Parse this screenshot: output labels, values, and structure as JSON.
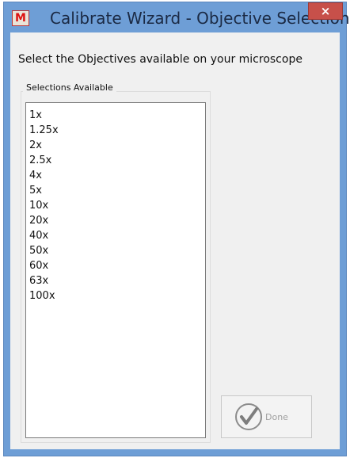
{
  "window": {
    "title": "Calibrate Wizard - Objective Selection",
    "app_icon_glyph": "M",
    "close_glyph": "×"
  },
  "instructions": "Select the Objectives available on your microscope",
  "selections": {
    "label": "Selections Available",
    "items": [
      "1x",
      "1.25x",
      "2x",
      "2.5x",
      "4x",
      "5x",
      "10x",
      "20x",
      "40x",
      "50x",
      "60x",
      "63x",
      "100x"
    ]
  },
  "done_button": {
    "label": "Done",
    "icon": "checkmark-circle-icon",
    "enabled": false
  },
  "colors": {
    "titlebar": "#6e9ed6",
    "close": "#c7504a",
    "client": "#f0f0f0"
  }
}
